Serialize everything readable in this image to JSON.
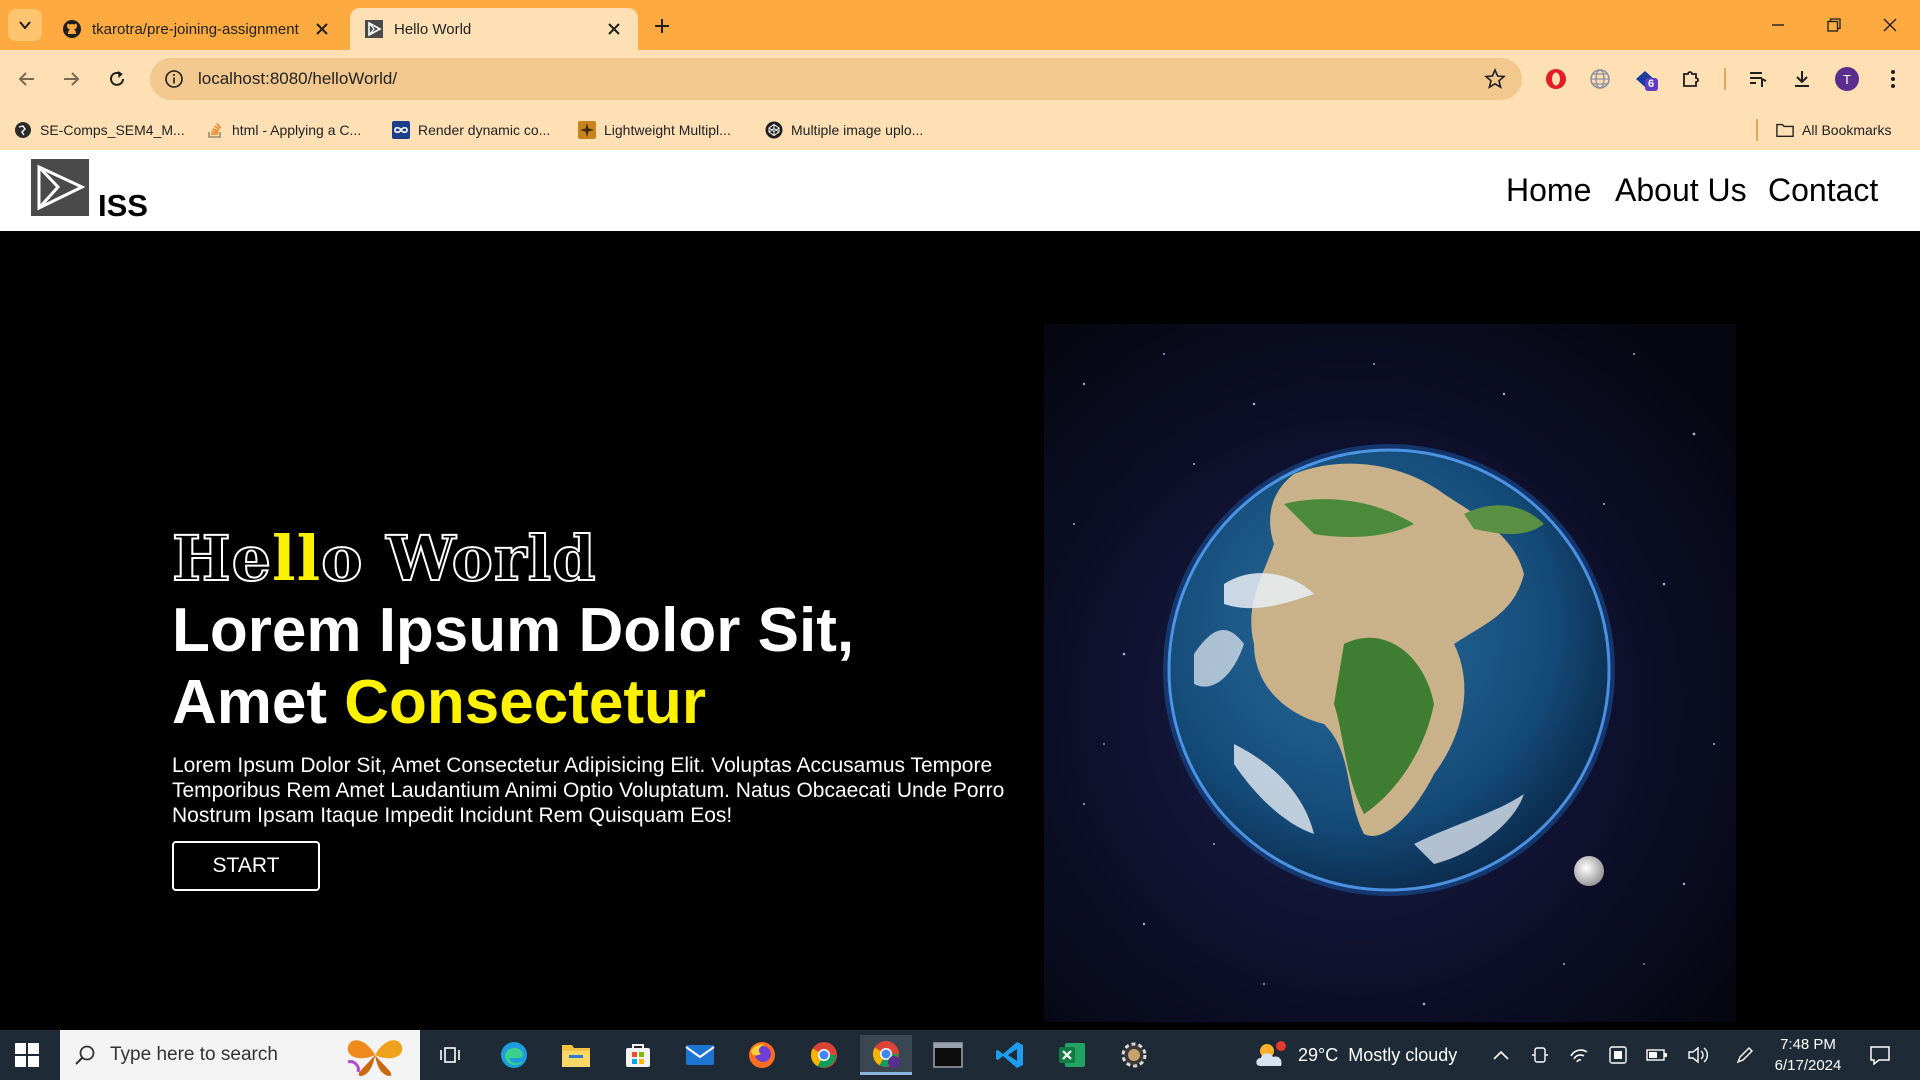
{
  "browser": {
    "tabs": [
      {
        "title": "tkarotra/pre-joining-assignment",
        "favicon": "github-icon"
      },
      {
        "title": "Hello World",
        "favicon": "play-logo-icon"
      }
    ],
    "address": "localhost:8080/helloWorld/",
    "extension_badge": "6",
    "profile_initial": "T",
    "bookmarks": [
      {
        "label": "SE-Comps_SEM4_M..."
      },
      {
        "label": "html - Applying a C..."
      },
      {
        "label": "Render dynamic co..."
      },
      {
        "label": "Lightweight Multipl..."
      },
      {
        "label": "Multiple image uplo..."
      }
    ],
    "all_bookmarks": "All Bookmarks",
    "accent": "#fdab41"
  },
  "site": {
    "logo_text": "ISS",
    "nav": [
      "Home",
      "About Us",
      "Contact"
    ],
    "hero": {
      "hello_parts": [
        "He",
        "ll",
        "o World"
      ],
      "headline_line1": "Lorem Ipsum Dolor Sit,",
      "headline_line2_plain": "Amet ",
      "headline_line2_accent": "Consectetur",
      "paragraph": "Lorem Ipsum Dolor Sit, Amet Consectetur Adipisicing Elit. Voluptas Accusamus Tempore Temporibus Rem Amet Laudantium Animi Optio Voluptatum. Natus Obcaecati Unde Porro Nostrum Ipsam Itaque Impedit Incidunt Rem Quisquam Eos!",
      "button": "START"
    },
    "accent_color": "#fcf200"
  },
  "taskbar": {
    "search_placeholder": "Type here to search",
    "weather_temp": "29°C",
    "weather_desc": "Mostly cloudy",
    "time": "7:48 PM",
    "date": "6/17/2024"
  }
}
